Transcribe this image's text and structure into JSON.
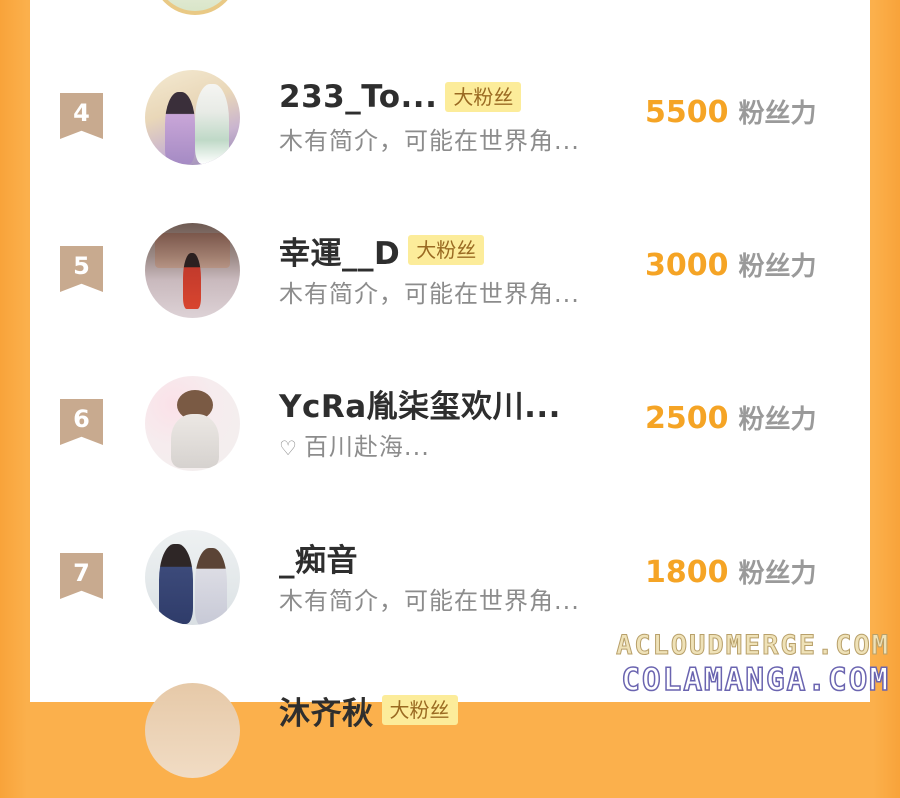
{
  "ranking": [
    {
      "rank": "4",
      "name": "233_To...",
      "badge": "大粉丝",
      "desc": "木有简介，可能在世界角...",
      "score": "5500",
      "unit": "粉丝力",
      "heart": false
    },
    {
      "rank": "5",
      "name": "幸運__D",
      "badge": "大粉丝",
      "desc": "木有简介，可能在世界角...",
      "score": "3000",
      "unit": "粉丝力",
      "heart": false
    },
    {
      "rank": "6",
      "name": "YcRa胤柒玺欢川...",
      "badge": "",
      "desc": "百川赴海...",
      "score": "2500",
      "unit": "粉丝力",
      "heart": true
    },
    {
      "rank": "7",
      "name": "_痴音",
      "badge": "",
      "desc": "木有简介，可能在世界角...",
      "score": "1800",
      "unit": "粉丝力",
      "heart": false
    },
    {
      "rank": "",
      "name": "沐齐秋",
      "badge": "大粉丝",
      "desc": "",
      "score": "",
      "unit": "",
      "heart": false
    }
  ],
  "icons": {
    "heart": "♡"
  },
  "colors": {
    "score": "#f5a425",
    "badge_bg": "#fcec9a",
    "rank_bg": "#c8aa8f",
    "frame": "#fbb04c"
  },
  "watermark": {
    "line1": "ACLOUDMERGE.COM",
    "line2": "COLAMANGA.COM"
  }
}
